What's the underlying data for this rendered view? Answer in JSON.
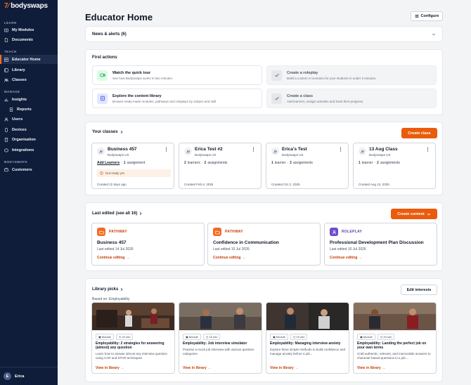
{
  "brand": {
    "name": "bodyswaps",
    "accent": "#f26b21"
  },
  "sidebar": {
    "sections": {
      "learn": "LEARN",
      "teach": "TEACH",
      "manage": "MANAGE",
      "bodyswaps": "BODYSWAPS"
    },
    "items": {
      "my_modules": "My Modules",
      "documents": "Documents",
      "educator_home": "Educator Home",
      "library": "Library",
      "classes": "Classes",
      "insights": "Insights",
      "reports": "Reports",
      "users": "Users",
      "devices": "Devices",
      "organisation": "Organisation",
      "integrations": "Integrations",
      "customers": "Customers"
    },
    "user": {
      "initial": "E",
      "name": "Erica"
    }
  },
  "header": {
    "title": "Educator Home",
    "configure_label": "Configure"
  },
  "news": {
    "label": "News & alerts",
    "count": "(6)"
  },
  "first_actions": {
    "heading": "First actions",
    "items": [
      {
        "title": "Watch the quick tour",
        "desc": "See how Bodyswaps works in two minutes."
      },
      {
        "title": "Create a roleplay",
        "desc": "Build a custom AI scenario for your students in under 3 minutes."
      },
      {
        "title": "Explore the content library",
        "desc": "Browse ready-made modules, pathways and roleplays by subject and skill."
      },
      {
        "title": "Create a class",
        "desc": "Add learners, assign activities and track their progress."
      }
    ]
  },
  "classes": {
    "heading": "Your classes",
    "create_label": "Create class",
    "items": [
      {
        "name": "Business 457",
        "org": "Bodyswaps US",
        "add_learners": "Add Learners",
        "assignments_count": "1",
        "assignments_label": "assignment",
        "warning": "Not ready yet",
        "created": "Created 22 days ago"
      },
      {
        "name": "Erica Test #2",
        "org": "Bodyswaps US",
        "learners_count": "2",
        "learners_label": "learners",
        "assignments_count": "2",
        "assignments_label": "assignments",
        "created": "Created Feb 6, 2026"
      },
      {
        "name": "Erica's Test",
        "org": "Bodyswaps US",
        "learners_count": "1",
        "learners_label": "learner",
        "assignments_count": "3",
        "assignments_label": "assignments",
        "created": "Created Oct 2, 2025"
      },
      {
        "name": "13 Aug Class",
        "org": "Bodyswaps US",
        "learners_count": "1",
        "learners_label": "learner",
        "assignments_count": "2",
        "assignments_label": "assignments",
        "created": "Created Aug 13, 2025"
      }
    ]
  },
  "last_edited": {
    "heading": "Last edited",
    "see_all": "(see all 16)",
    "create_label": "Create content",
    "items": [
      {
        "type": "PATHWAY",
        "name": "Business 457",
        "date": "Last edited 14 Jul 2026",
        "action": "Continue editing"
      },
      {
        "type": "PATHWAY",
        "name": "Confidence in Communication",
        "date": "Last edited 10 Jul 2026",
        "action": "Continue editing"
      },
      {
        "type": "ROLEPLAY",
        "name": "Professional Development Plan Discussion",
        "date": "Last edited 10 Jul 2026",
        "action": "Continue editing"
      }
    ]
  },
  "library_picks": {
    "heading": "Library picks",
    "based_on": "Based on: Employability",
    "edit_label": "Edit interests",
    "items": [
      {
        "tag": "Module",
        "duration": "20 min",
        "title": "Employability: 2 strategies for answering (almost) any question",
        "desc": "Learn how to answer almost any interview question using CAR and STAR techniques",
        "action": "View in library"
      },
      {
        "tag": "Module",
        "duration": "15 min",
        "title": "Employability: Job interview simulator",
        "desc": "Practise a mock job interview with various question categories",
        "action": "View in library"
      },
      {
        "tag": "Module",
        "duration": "15 min",
        "title": "Employability: Managing interview anxiety",
        "desc": "Explore three simple methods to build confidence and manage anxiety before a job...",
        "action": "View in library"
      },
      {
        "tag": "Module",
        "duration": "20 min",
        "title": "Employability: Landing the perfect job on your own terms",
        "desc": "Craft authentic, relevant, and memorable answers to character-based questions in a job...",
        "action": "View in library"
      }
    ]
  }
}
